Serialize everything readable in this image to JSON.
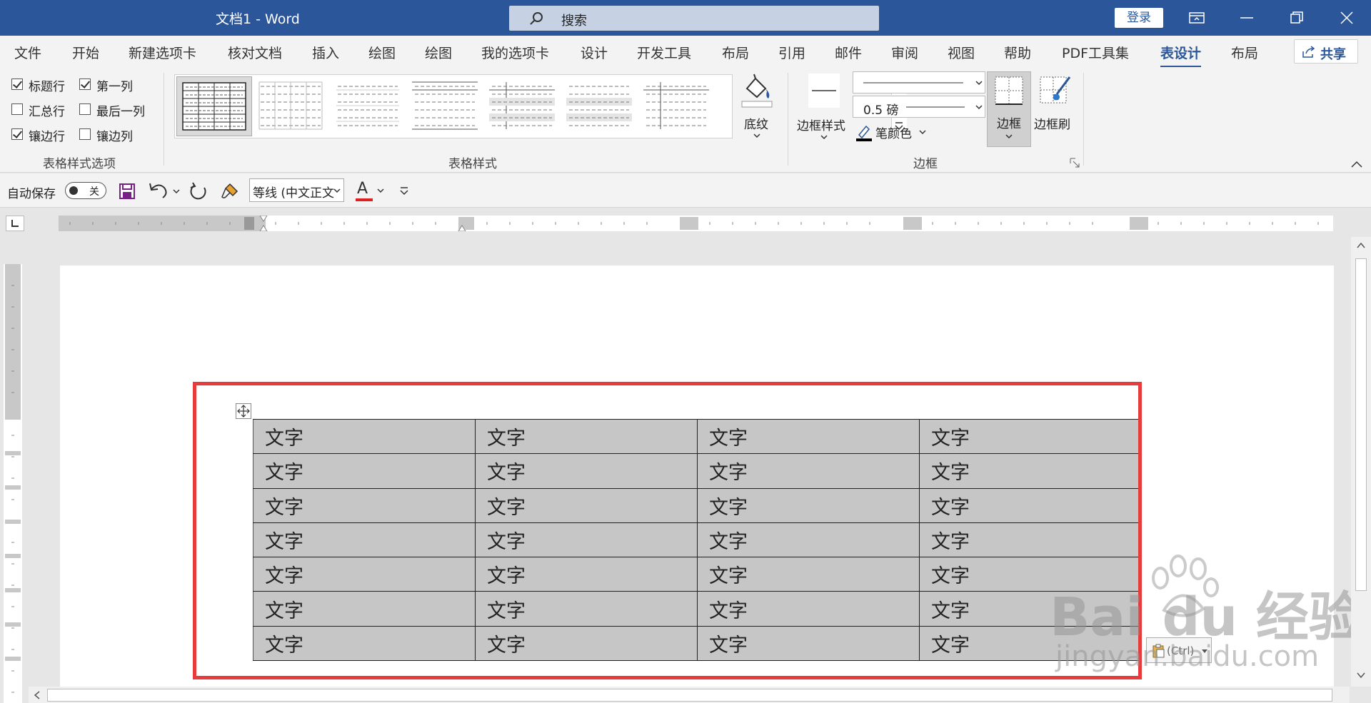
{
  "titlebar": {
    "doc_title": "文档1  -  Word",
    "search_placeholder": "搜索",
    "login_label": "登录"
  },
  "tabs": [
    "文件",
    "开始",
    "新建选项卡",
    "核对文档",
    "插入",
    "绘图",
    "绘图",
    "我的选项卡",
    "设计",
    "开发工具",
    "布局",
    "引用",
    "邮件",
    "审阅",
    "视图",
    "帮助",
    "PDF工具集",
    "表设计",
    "布局"
  ],
  "active_tab": "表设计",
  "share_label": "共享",
  "ribbon": {
    "style_options": {
      "items": [
        {
          "label": "标题行",
          "checked": true
        },
        {
          "label": "第一列",
          "checked": true
        },
        {
          "label": "汇总行",
          "checked": false
        },
        {
          "label": "最后一列",
          "checked": false
        },
        {
          "label": "镶边行",
          "checked": true
        },
        {
          "label": "镶边列",
          "checked": false
        }
      ],
      "group_label": "表格样式选项"
    },
    "table_styles": {
      "group_label": "表格样式",
      "shading_label": "底纹"
    },
    "borders": {
      "group_label": "边框",
      "border_styles_label": "边框样式",
      "line_weight": "0.5 磅",
      "pen_color_label": "笔颜色",
      "border_label": "边框",
      "border_painter_label": "边框刷"
    }
  },
  "qat": {
    "autosave_label": "自动保存",
    "toggle_state": "关",
    "font_name": "等线 (中文正文",
    "font_color_glyph": "A"
  },
  "document": {
    "table": [
      [
        "文字",
        "文字",
        "文字",
        "文字"
      ],
      [
        "文字",
        "文字",
        "文字",
        "文字"
      ],
      [
        "文字",
        "文字",
        "文字",
        "文字"
      ],
      [
        "文字",
        "文字",
        "文字",
        "文字"
      ],
      [
        "文字",
        "文字",
        "文字",
        "文字"
      ],
      [
        "文字",
        "文字",
        "文字",
        "文字"
      ],
      [
        "文字",
        "文字",
        "文字",
        "文字"
      ]
    ],
    "paste_options_label": "(Ctrl)"
  },
  "watermark": {
    "line1": "Bai du 经验",
    "line2": "jingyan.baidu.com"
  },
  "colors": {
    "brand": "#2b579a",
    "highlight_frame": "#e83b3b",
    "cell_shading": "#c6c6c6"
  }
}
